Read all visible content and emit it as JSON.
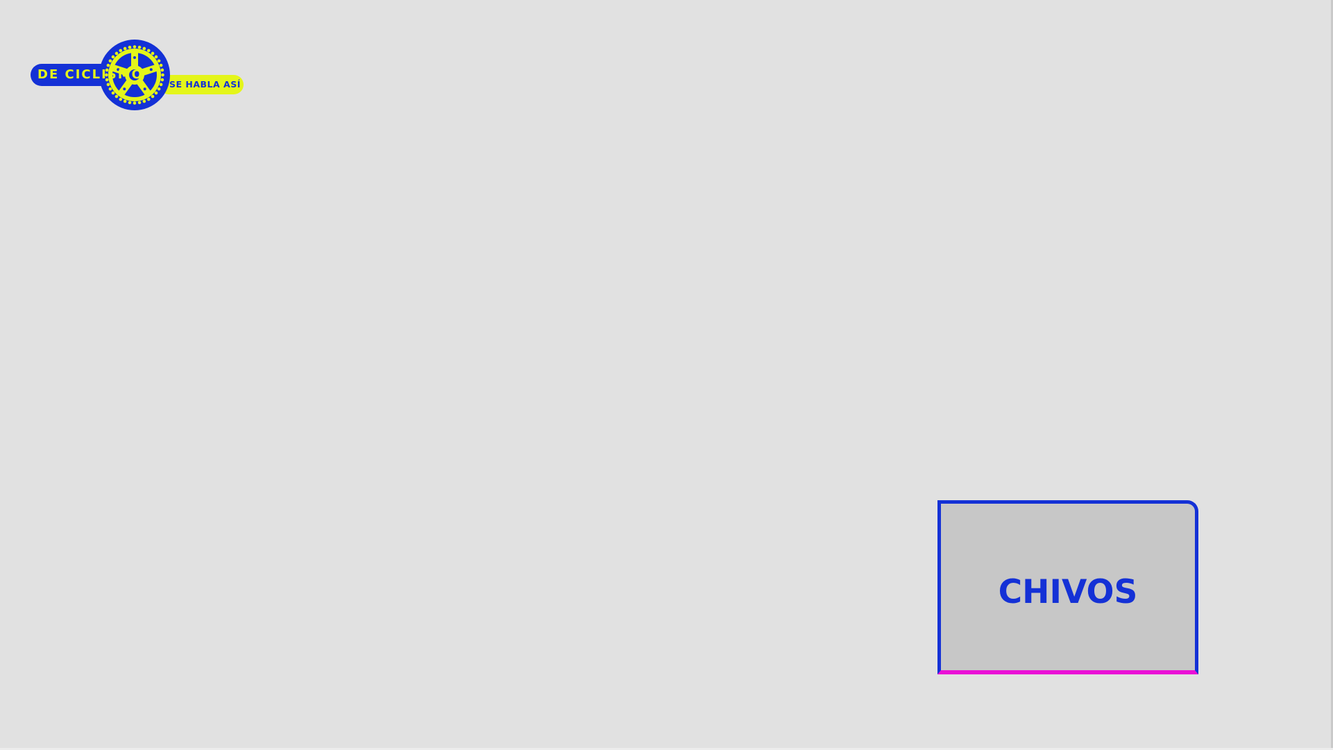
{
  "logo": {
    "left_text": "DE CICLISMO",
    "right_text": "SE HABLA ASÍ",
    "icon": "chainring-gear-icon"
  },
  "card": {
    "title": "CHIVOS"
  },
  "colors": {
    "background": "#e1e1e1",
    "brand_blue": "#1431d6",
    "brand_yellow": "#e4f51a",
    "accent_magenta": "#ea0fd6",
    "card_fill": "#c7c7c7"
  }
}
